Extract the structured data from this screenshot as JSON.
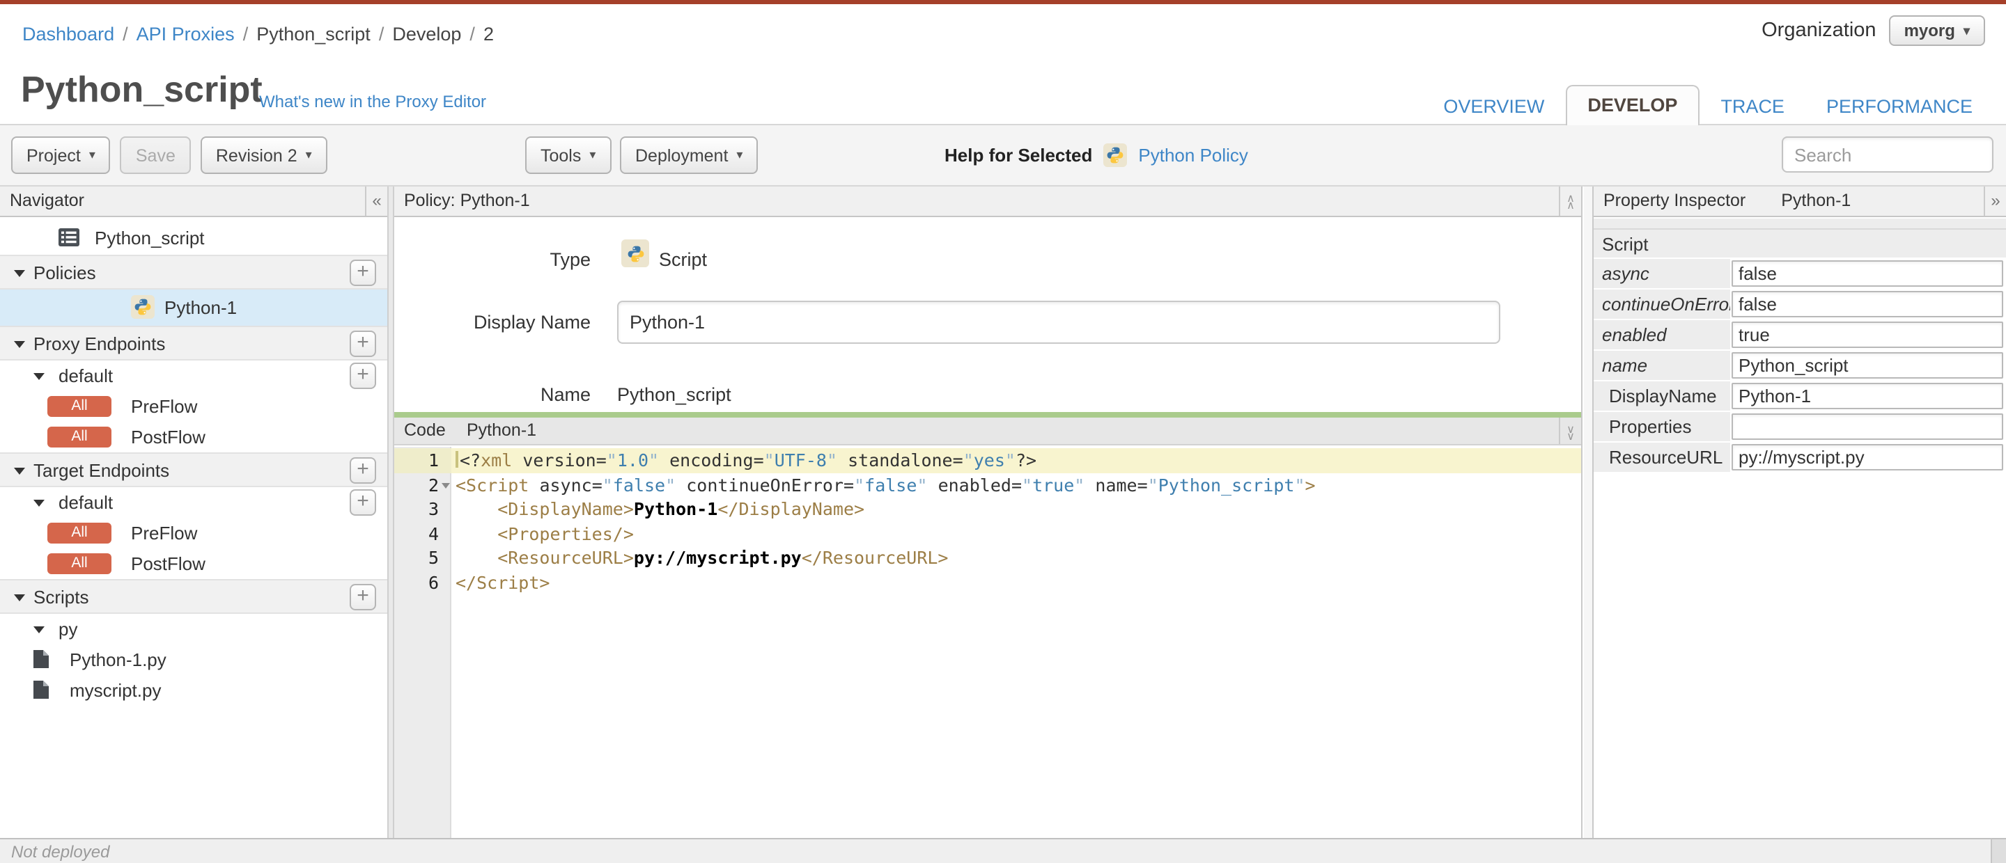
{
  "colors": {
    "top_bar": "#a5402a",
    "link": "#3e86c7",
    "badge_all": "#d5664b",
    "selected_row": "#d8ebf8",
    "active_line": "#f8f4cf",
    "code_green_bar": "#aacb8c",
    "tab_active_text": "#50463f",
    "code_tag": "#9c7e46",
    "code_string": "#3f7fae"
  },
  "topbar": {
    "breadcrumb": [
      {
        "label": "Dashboard",
        "link": true
      },
      {
        "label": "API Proxies",
        "link": true
      },
      {
        "label": "Python_script",
        "link": false
      },
      {
        "label": "Develop",
        "link": false
      },
      {
        "label": "2",
        "link": false
      }
    ],
    "organization_label": "Organization",
    "organization_value": "myorg"
  },
  "header": {
    "title": "Python_script",
    "whats_new_link": "What's new in the Proxy Editor",
    "tabs": [
      {
        "label": "OVERVIEW",
        "active": false
      },
      {
        "label": "DEVELOP",
        "active": true
      },
      {
        "label": "TRACE",
        "active": false
      },
      {
        "label": "PERFORMANCE",
        "active": false
      }
    ]
  },
  "toolbar": {
    "project_label": "Project",
    "save_label": "Save",
    "revision_label": "Revision 2",
    "tools_label": "Tools",
    "deployment_label": "Deployment",
    "help_label": "Help for Selected",
    "help_icon": "python-icon",
    "help_link": "Python Policy",
    "search_placeholder": "Search"
  },
  "navigator": {
    "title": "Navigator",
    "collapse_icon": "«",
    "tree": [
      {
        "type": "root",
        "label": "Python_script",
        "icon": "proxy-doc-icon"
      },
      {
        "type": "section",
        "label": "Policies",
        "expanded": true,
        "add": true
      },
      {
        "type": "policy",
        "label": "Python-1",
        "icon": "python-icon",
        "selected": true
      },
      {
        "type": "section",
        "label": "Proxy Endpoints",
        "expanded": true,
        "add": true
      },
      {
        "type": "node",
        "label": "default",
        "expanded": true,
        "add": true
      },
      {
        "type": "flow",
        "label": "PreFlow",
        "badge": "All"
      },
      {
        "type": "flow",
        "label": "PostFlow",
        "badge": "All"
      },
      {
        "type": "section",
        "label": "Target Endpoints",
        "expanded": true,
        "add": true
      },
      {
        "type": "node",
        "label": "default",
        "expanded": true,
        "add": true
      },
      {
        "type": "flow",
        "label": "PreFlow",
        "badge": "All"
      },
      {
        "type": "flow",
        "label": "PostFlow",
        "badge": "All"
      },
      {
        "type": "section",
        "label": "Scripts",
        "expanded": true,
        "add": true
      },
      {
        "type": "node",
        "label": "py",
        "expanded": true,
        "add": false
      },
      {
        "type": "file",
        "label": "Python-1.py",
        "icon": "file-icon"
      },
      {
        "type": "file",
        "label": "myscript.py",
        "icon": "file-icon"
      }
    ]
  },
  "policy": {
    "panel_header": "Policy: Python-1",
    "type_label": "Type",
    "type_icon": "python-icon",
    "type_value": "Script",
    "display_name_label": "Display Name",
    "display_name_value": "Python-1",
    "name_label": "Name",
    "name_value": "Python_script"
  },
  "code": {
    "tab_label": "Code",
    "file_label": "Python-1",
    "lines": [
      {
        "no": "1",
        "active": true,
        "fold": false,
        "tokens": [
          [
            "pm",
            "<?"
          ],
          [
            "tag",
            "xml"
          ],
          [
            "pl",
            " "
          ],
          [
            "attr",
            "version"
          ],
          [
            "pl",
            "="
          ],
          [
            "q",
            "\""
          ],
          [
            "str",
            "1.0"
          ],
          [
            "q",
            "\""
          ],
          [
            "pl",
            " "
          ],
          [
            "attr",
            "encoding"
          ],
          [
            "pl",
            "="
          ],
          [
            "q",
            "\""
          ],
          [
            "str",
            "UTF-8"
          ],
          [
            "q",
            "\""
          ],
          [
            "pl",
            " "
          ],
          [
            "attr",
            "standalone"
          ],
          [
            "pl",
            "="
          ],
          [
            "q",
            "\""
          ],
          [
            "str",
            "yes"
          ],
          [
            "q",
            "\""
          ],
          [
            "pm",
            "?>"
          ]
        ]
      },
      {
        "no": "2",
        "active": false,
        "fold": true,
        "tokens": [
          [
            "tag",
            "<Script"
          ],
          [
            "pl",
            " "
          ],
          [
            "attr",
            "async"
          ],
          [
            "pl",
            "="
          ],
          [
            "q",
            "\""
          ],
          [
            "str",
            "false"
          ],
          [
            "q",
            "\""
          ],
          [
            "pl",
            " "
          ],
          [
            "attr",
            "continueOnError"
          ],
          [
            "pl",
            "="
          ],
          [
            "q",
            "\""
          ],
          [
            "str",
            "false"
          ],
          [
            "q",
            "\""
          ],
          [
            "pl",
            " "
          ],
          [
            "attr",
            "enabled"
          ],
          [
            "pl",
            "="
          ],
          [
            "q",
            "\""
          ],
          [
            "str",
            "true"
          ],
          [
            "q",
            "\""
          ],
          [
            "pl",
            " "
          ],
          [
            "attr",
            "name"
          ],
          [
            "pl",
            "="
          ],
          [
            "q",
            "\""
          ],
          [
            "str",
            "Python_script"
          ],
          [
            "q",
            "\""
          ],
          [
            "tag",
            ">"
          ]
        ]
      },
      {
        "no": "3",
        "active": false,
        "fold": false,
        "tokens": [
          [
            "pl",
            "    "
          ],
          [
            "tag",
            "<DisplayName>"
          ],
          [
            "txt",
            "Python-1"
          ],
          [
            "tag",
            "</DisplayName>"
          ]
        ]
      },
      {
        "no": "4",
        "active": false,
        "fold": false,
        "tokens": [
          [
            "pl",
            "    "
          ],
          [
            "tag",
            "<Properties/>"
          ]
        ]
      },
      {
        "no": "5",
        "active": false,
        "fold": false,
        "tokens": [
          [
            "pl",
            "    "
          ],
          [
            "tag",
            "<ResourceURL>"
          ],
          [
            "txt",
            "py://myscript.py"
          ],
          [
            "tag",
            "</ResourceURL>"
          ]
        ]
      },
      {
        "no": "6",
        "active": false,
        "fold": false,
        "tokens": [
          [
            "tag",
            "</Script>"
          ]
        ]
      }
    ]
  },
  "inspector": {
    "title": "Property Inspector",
    "subtitle": "Python-1",
    "expand_icon": "»",
    "rows": [
      {
        "kind": "section",
        "label": "Script",
        "value": null
      },
      {
        "kind": "attr",
        "label": "async",
        "value": "false"
      },
      {
        "kind": "attr",
        "label": "continueOnError",
        "value": "false"
      },
      {
        "kind": "attr",
        "label": "enabled",
        "value": "true"
      },
      {
        "kind": "attr",
        "label": "name",
        "value": "Python_script"
      },
      {
        "kind": "elem",
        "label": "DisplayName",
        "value": "Python-1"
      },
      {
        "kind": "elem",
        "label": "Properties",
        "value": ""
      },
      {
        "kind": "elem",
        "label": "ResourceURL",
        "value": "py://myscript.py"
      }
    ]
  },
  "status_bar": {
    "text": "Not deployed"
  }
}
